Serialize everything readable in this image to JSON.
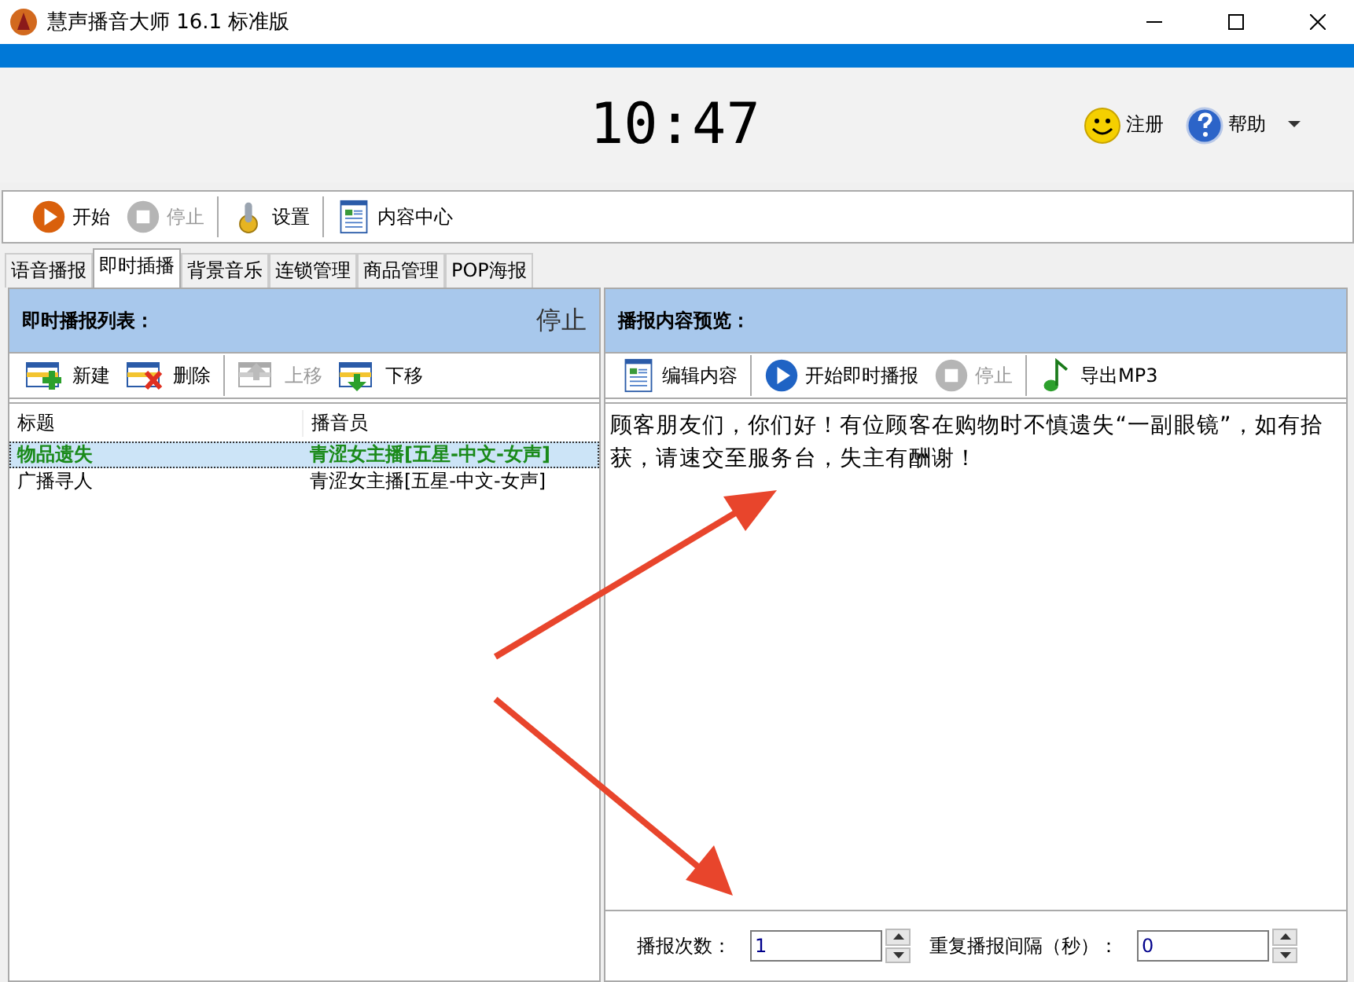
{
  "window": {
    "title": "慧声播音大师 16.1 标准版"
  },
  "clock": "10:47",
  "header_links": [
    {
      "kind": "register",
      "label": "注册"
    },
    {
      "kind": "help",
      "label": "帮助"
    }
  ],
  "main_toolbar": [
    [
      {
        "kind": "play",
        "label": "开始",
        "disabled": false
      },
      {
        "kind": "stop",
        "label": "停止",
        "disabled": true
      }
    ],
    [
      {
        "kind": "settings",
        "label": "设置",
        "disabled": false
      }
    ],
    [
      {
        "kind": "document",
        "label": "内容中心",
        "disabled": false
      }
    ]
  ],
  "tabs": [
    {
      "label": "语音播报",
      "selected": false
    },
    {
      "label": "即时插播",
      "selected": true
    },
    {
      "label": "背景音乐",
      "selected": false
    },
    {
      "label": "连锁管理",
      "selected": false
    },
    {
      "label": "商品管理",
      "selected": false
    },
    {
      "label": "POP海报",
      "selected": false
    }
  ],
  "list_panel": {
    "title": "即时播报列表：",
    "status": "停止",
    "toolbar": [
      [
        {
          "kind": "new",
          "label": "新建",
          "disabled": false
        },
        {
          "kind": "delete",
          "label": "删除",
          "disabled": false
        }
      ],
      [
        {
          "kind": "up",
          "label": "上移",
          "disabled": true
        },
        {
          "kind": "down",
          "label": "下移",
          "disabled": false
        }
      ]
    ],
    "table": {
      "columns": [
        "标题",
        "播音员"
      ],
      "rows": [
        {
          "cells": [
            "物品遗失",
            "青涩女主播[五星-中文-女声]"
          ],
          "selected": true
        },
        {
          "cells": [
            "广播寻人",
            "青涩女主播[五星-中文-女声]"
          ],
          "selected": false
        }
      ]
    }
  },
  "preview_panel": {
    "title": "播报内容预览：",
    "toolbar": [
      [
        {
          "kind": "document",
          "label": "编辑内容",
          "disabled": false
        }
      ],
      [
        {
          "kind": "play-blue",
          "label": "开始即时播报",
          "disabled": false
        },
        {
          "kind": "stop",
          "label": "停止",
          "disabled": true
        }
      ],
      [
        {
          "kind": "music",
          "label": "导出MP3",
          "disabled": false
        }
      ]
    ],
    "text": "顾客朋友们，你们好！有位顾客在购物时不慎遗失“一副眼镜”，如有拾获，请速交至服务台，失主有酬谢！",
    "fields": [
      {
        "label": "播报次数：",
        "value": "1"
      },
      {
        "label": "重复播报间隔（秒）：",
        "value": "0"
      }
    ]
  }
}
